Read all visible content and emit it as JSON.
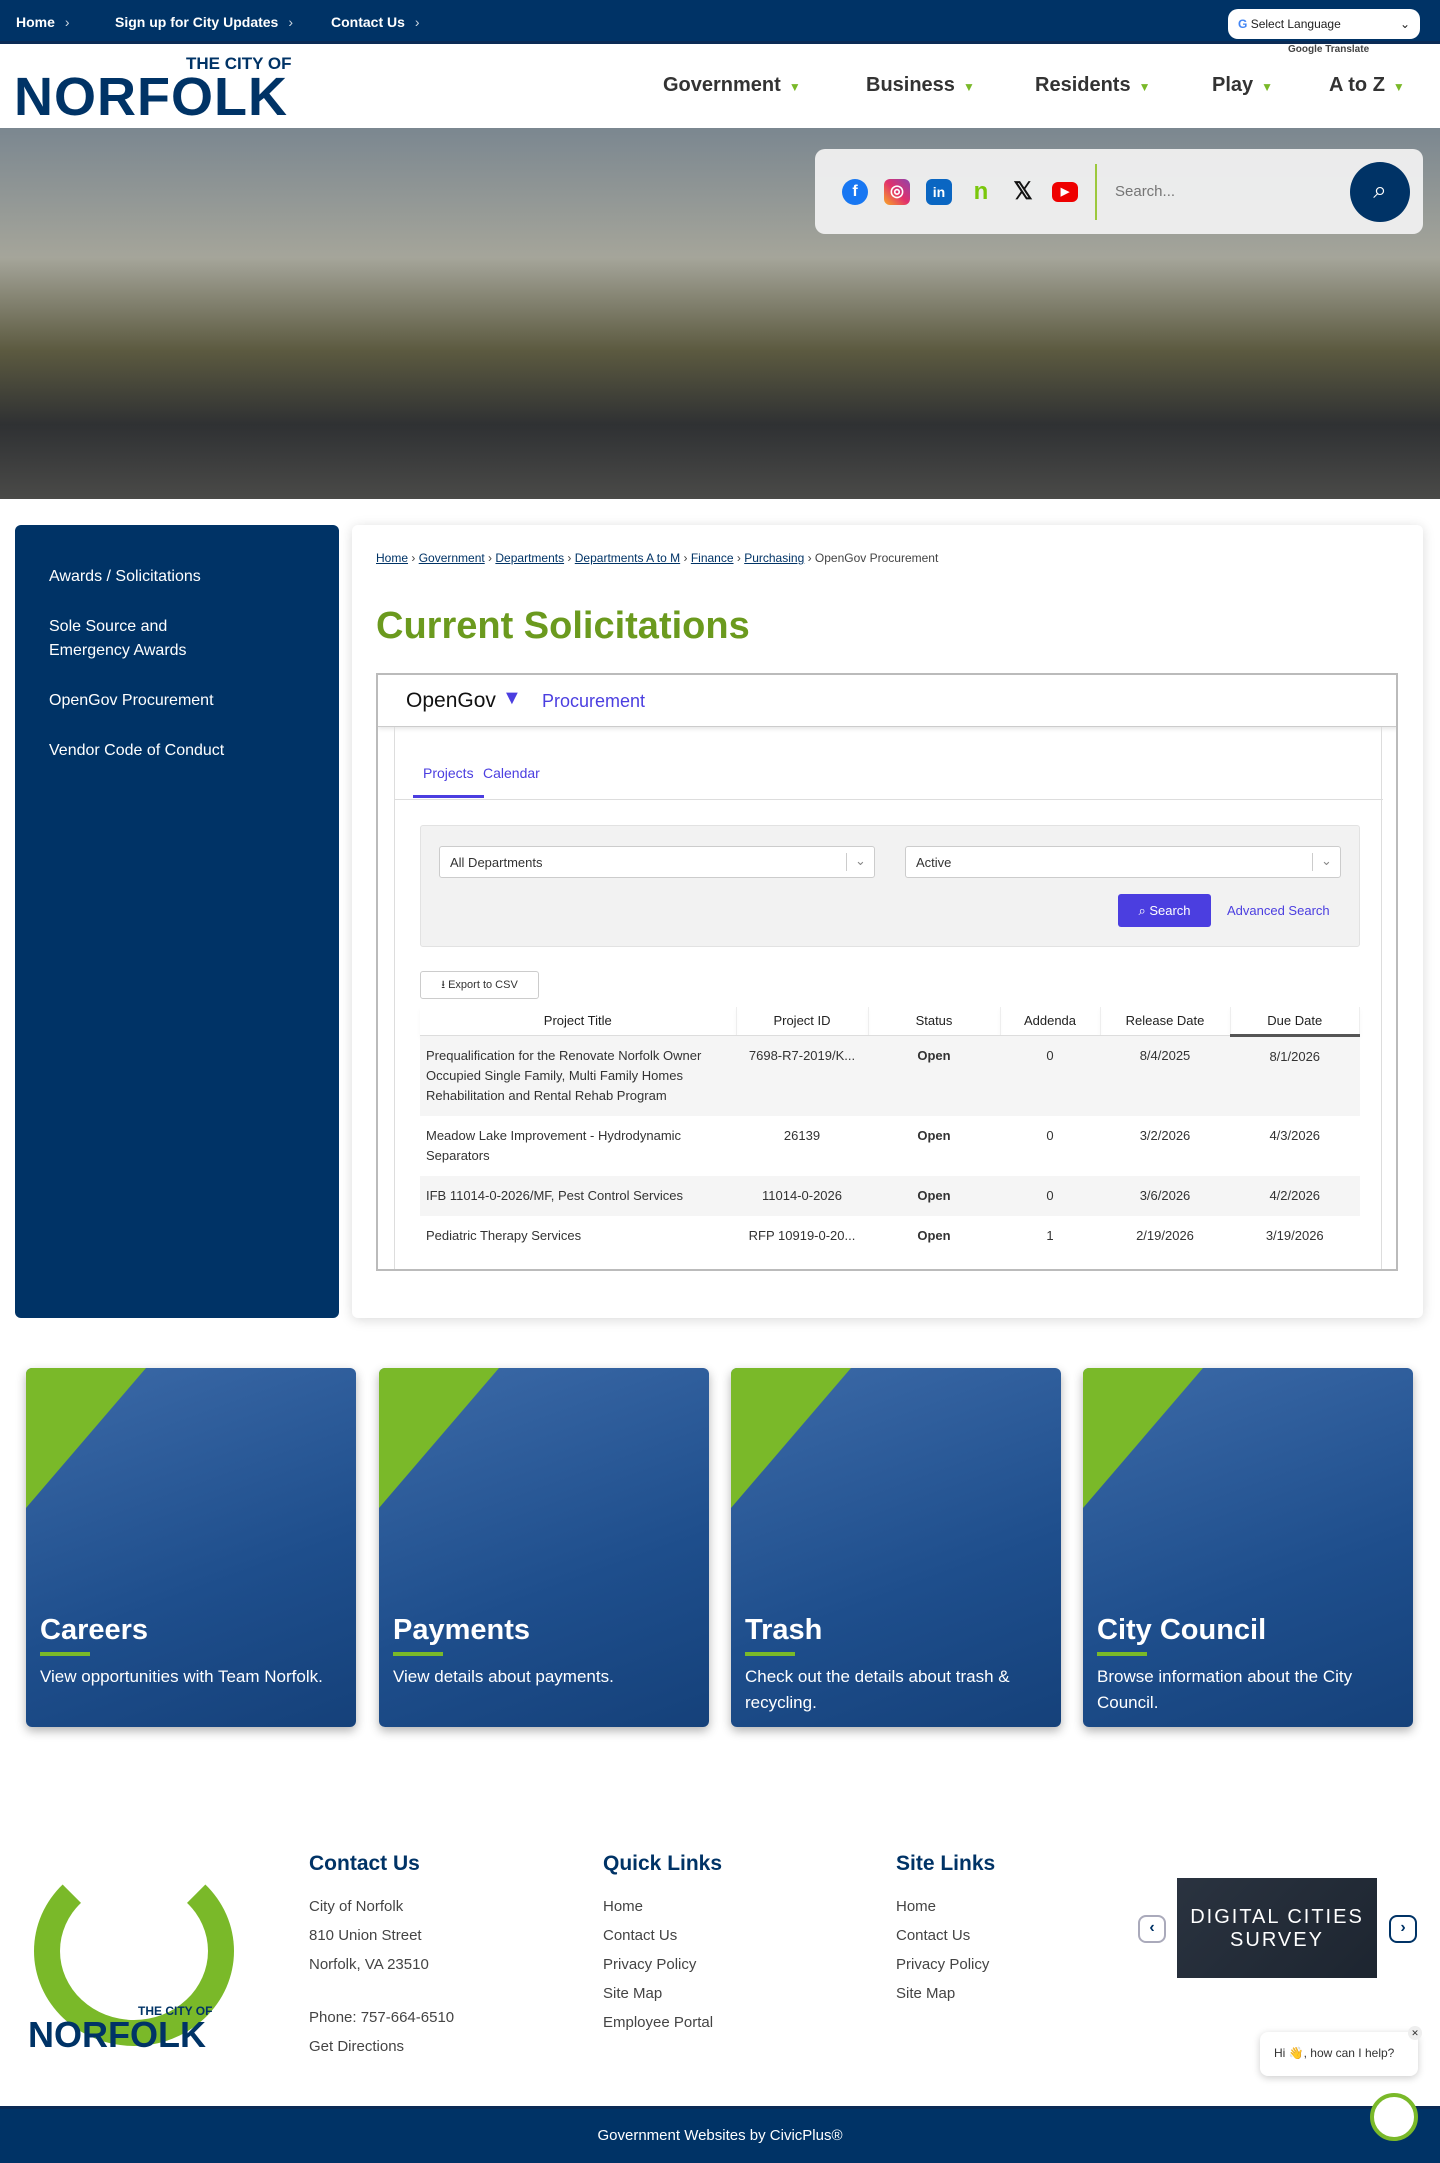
{
  "topbar": {
    "links": [
      "Home",
      "Sign up for City Updates",
      "Contact Us"
    ],
    "language_select": "Select Language",
    "translate_label": "Google Translate"
  },
  "logo": {
    "line1": "THE CITY OF",
    "line2": "NORFOLK"
  },
  "nav": [
    "Government",
    "Business",
    "Residents",
    "Play",
    "A to Z"
  ],
  "search": {
    "placeholder": "Search...",
    "social": [
      "facebook",
      "instagram",
      "linkedin",
      "nextdoor",
      "x",
      "youtube"
    ]
  },
  "sidebar": {
    "items": [
      "Awards / Solicitations",
      "Sole Source and Emergency Awards",
      "OpenGov Procurement",
      "Vendor Code of Conduct"
    ]
  },
  "breadcrumb": {
    "links": [
      "Home",
      "Government",
      "Departments",
      "Departments A to M",
      "Finance",
      "Purchasing"
    ],
    "current": "OpenGov Procurement"
  },
  "page_title": "Current Solicitations",
  "opengov": {
    "brand": "OpenGov",
    "product": "Procurement",
    "tabs": [
      "Projects",
      "Calendar"
    ],
    "department_filter": "All Departments",
    "status_filter": "Active",
    "search_label": "Search",
    "advanced_search_label": "Advanced Search",
    "export_label": "Export to CSV",
    "columns": [
      "Project Title",
      "Project ID",
      "Status",
      "Addenda",
      "Release Date",
      "Due Date"
    ],
    "rows": [
      [
        "Prequalification for the Renovate Norfolk Owner Occupied Single Family, Multi Family Homes Rehabilitation and Rental Rehab Program",
        "7698-R7-2019/K...",
        "Open",
        "0",
        "8/4/2025",
        "8/1/2026"
      ],
      [
        "Meadow Lake Improvement - Hydrodynamic Separators",
        "26139",
        "Open",
        "0",
        "3/2/2026",
        "4/3/2026"
      ],
      [
        "IFB 11014-0-2026/MF, Pest Control Services",
        "11014-0-2026",
        "Open",
        "0",
        "3/6/2026",
        "4/2/2026"
      ],
      [
        "Pediatric Therapy Services",
        "RFP 10919-0-20...",
        "Open",
        "1",
        "2/19/2026",
        "3/19/2026"
      ]
    ]
  },
  "tiles": [
    {
      "title": "Careers",
      "text": "View opportunities with Team Norfolk."
    },
    {
      "title": "Payments",
      "text": "View details about payments."
    },
    {
      "title": "Trash",
      "text": "Check out the details about trash & recycling."
    },
    {
      "title": "City Council",
      "text": "Browse information about the City Council."
    }
  ],
  "footer": {
    "contact": {
      "heading": "Contact Us",
      "lines": [
        "City of Norfolk",
        "810 Union Street",
        "Norfolk, VA 23510"
      ],
      "phone": "Phone: 757-664-6510",
      "directions": "Get Directions"
    },
    "quick": {
      "heading": "Quick Links",
      "links": [
        "Home",
        "Contact Us",
        "Privacy Policy",
        "Site Map",
        "Employee Portal"
      ]
    },
    "site": {
      "heading": "Site Links",
      "links": [
        "Home",
        "Contact Us",
        "Privacy Policy",
        "Site Map"
      ]
    },
    "badge": "DIGITAL CITIES SURVEY",
    "chat": "Hi 👋, how can I help?",
    "credit": "Government Websites by CivicPlus®"
  },
  "colors": {
    "navy": "#003366",
    "green": "#7ab929",
    "title_green": "#6b9a1e",
    "opengov_purple": "#4b3ee0",
    "open_status": "#1d8a3a"
  }
}
